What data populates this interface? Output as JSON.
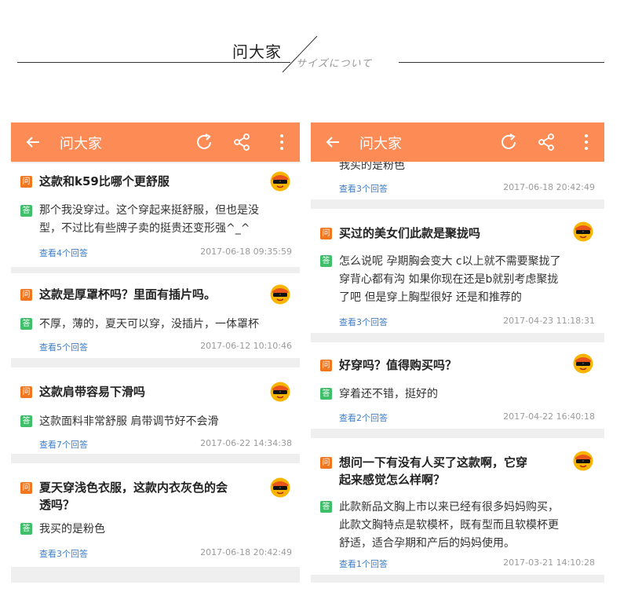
{
  "header": {
    "title": "问大家",
    "subtitle": "サイズについて"
  },
  "app": {
    "title": "问大家",
    "accent_color": "#fc8b56",
    "question_badge": "问",
    "answer_badge": "答"
  },
  "left_panel": {
    "cards": [
      {
        "question": "这款和k59比哪个更舒服",
        "answer_lines": [
          "那个我没穿过。这个穿起来挺舒服，但也是没",
          "型，不过比有些牌子卖的挺贵还变形强^_^"
        ],
        "link": "查看4个回答",
        "date": "2017-06-18 09:35:59"
      },
      {
        "question": "这款是厚罩杯吗？里面有插片吗。",
        "answer_lines": [
          "不厚，薄的，夏天可以穿，没插片，一体罩杯"
        ],
        "link": "查看5个回答",
        "date": "2017-06-12 10:10:46"
      },
      {
        "question": "这款肩带容易下滑吗",
        "answer_lines": [
          "这款面料非常舒服 肩带调节好不会滑"
        ],
        "link": "查看7个回答",
        "date": "2017-06-22 14:34:38"
      },
      {
        "question_lines": [
          "夏天穿浅色衣服，这款内衣灰色的会",
          "透吗？"
        ],
        "answer_lines": [
          "我买的是粉色"
        ],
        "link": "查看3个回答",
        "date": "2017-06-18 20:42:49"
      }
    ]
  },
  "right_panel": {
    "partial_card": {
      "answer_fragment": "我买的是粉色",
      "link": "查看3个回答",
      "date": "2017-06-18 20:42:49"
    },
    "cards": [
      {
        "question": "买过的美女们此款是聚拢吗",
        "answer_lines": [
          "怎么说呢 孕期胸会变大 c以上就不需要聚拢了",
          "穿背心都有沟 如果你现在还是b就别考虑聚拢",
          "了吧 但是穿上胸型很好 还是和推荐的"
        ],
        "link": "查看3个回答",
        "date": "2017-04-23 11:18:31"
      },
      {
        "question": "好穿吗？值得购买吗？",
        "answer_lines": [
          "穿着还不错，挺好的"
        ],
        "link": "查看2个回答",
        "date": "2017-04-22 16:40:18"
      },
      {
        "question_lines": [
          "想问一下有没有人买了这款啊，它穿",
          "起来感觉怎么样啊？"
        ],
        "answer_lines": [
          "此款新品文胸上市以来已经有很多妈妈购买，",
          "此款文胸特点是软模杯，既有型而且软模杯更",
          "舒适，适合孕期和产后的妈妈使用。"
        ],
        "link": "查看1个回答",
        "date": "2017-03-21 14:10:28"
      }
    ]
  }
}
